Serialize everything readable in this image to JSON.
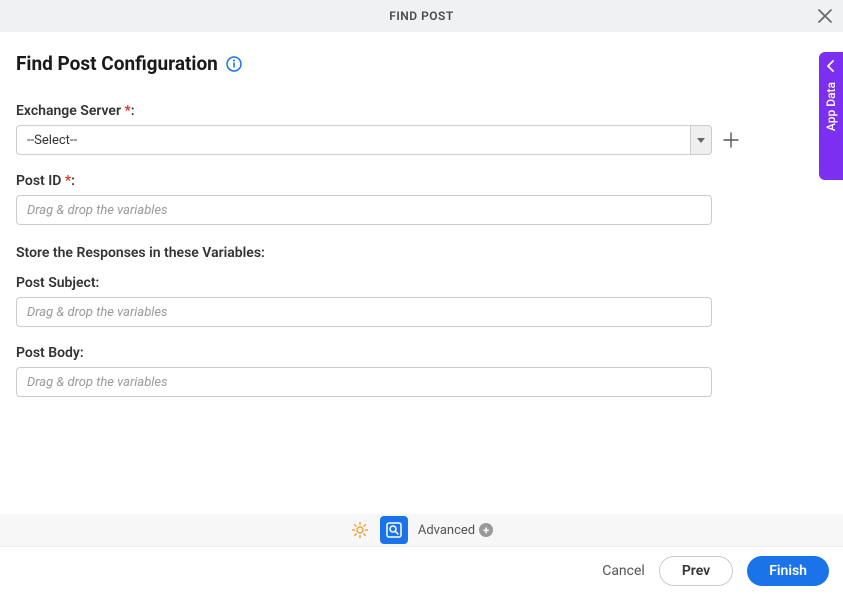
{
  "header": {
    "title": "FIND POST"
  },
  "page": {
    "title": "Find Post Configuration"
  },
  "fields": {
    "exchange_server": {
      "label": "Exchange Server ",
      "required_mark": "*",
      "colon": ":",
      "selected": "--Select--"
    },
    "post_id": {
      "label": "Post ID ",
      "required_mark": "*",
      "colon": ":",
      "placeholder": "Drag & drop the variables"
    },
    "section_label": "Store the Responses in these Variables:",
    "post_subject": {
      "label": "Post Subject:",
      "placeholder": "Drag & drop the variables"
    },
    "post_body": {
      "label": "Post Body:",
      "placeholder": "Drag & drop the variables"
    }
  },
  "sidetab": {
    "label": "App Data"
  },
  "toolbar": {
    "advanced_label": "Advanced"
  },
  "footer": {
    "cancel": "Cancel",
    "prev": "Prev",
    "finish": "Finish"
  }
}
